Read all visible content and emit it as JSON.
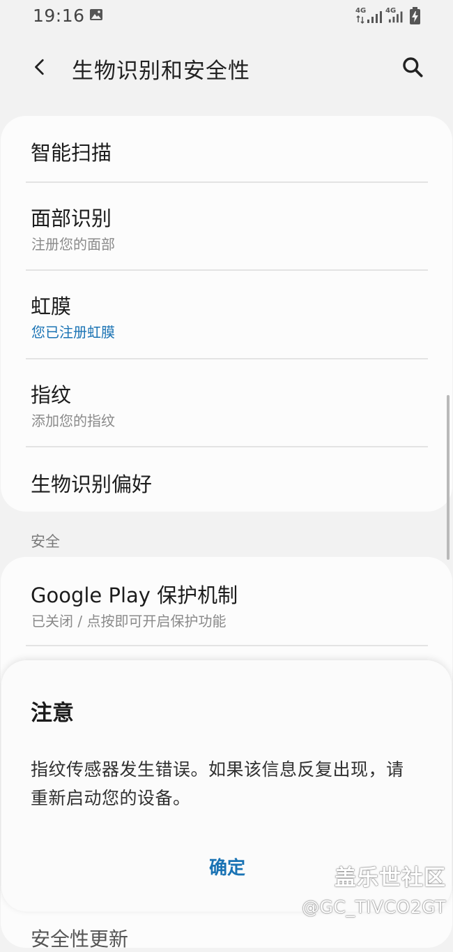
{
  "status_bar": {
    "time": "19:16",
    "network_1": "4G",
    "network_2": "4G",
    "icons": [
      "gallery-icon",
      "signal-icon",
      "battery-icon"
    ]
  },
  "app_bar": {
    "title": "生物识别和安全性",
    "back_icon": "chevron-left-icon",
    "search_icon": "search-icon"
  },
  "biometrics": {
    "items": [
      {
        "title": "智能扫描",
        "subtitle": ""
      },
      {
        "title": "面部识别",
        "subtitle": "注册您的面部"
      },
      {
        "title": "虹膜",
        "subtitle": "您已注册虹膜"
      },
      {
        "title": "指纹",
        "subtitle": "添加您的指纹"
      },
      {
        "title": "生物识别偏好",
        "subtitle": ""
      }
    ]
  },
  "security": {
    "header": "安全",
    "items": [
      {
        "title": "Google Play 保护机制",
        "subtitle": "已关闭 / 点按即可开启保护功能"
      }
    ],
    "partially_visible_item": "安全性更新"
  },
  "dialog": {
    "title": "注意",
    "message": "指纹传感器发生错误。如果该信息反复出现，请重新启动您的设备。",
    "ok_label": "确定"
  },
  "watermark": {
    "name": "盖乐世社区",
    "handle": "@GC_TIVCO2GT"
  },
  "colors": {
    "accent": "#1a73b4",
    "background": "#f2f2f2",
    "card": "#fcfcfc"
  }
}
